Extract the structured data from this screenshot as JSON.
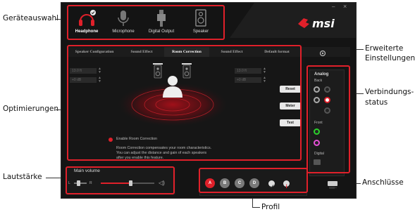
{
  "callouts": {
    "device_selection": "Geräteauswahl",
    "advanced_settings_line1": "Erweiterte",
    "advanced_settings_line2": "Einstellungen",
    "connection_status_line1": "Verbindungs-",
    "connection_status_line2": "status",
    "optimizations": "Optimierungen",
    "volume": "Lautstärke",
    "connectors": "Anschlüsse",
    "profile": "Profil"
  },
  "devices": [
    {
      "label": "Headphone",
      "icon": "headphone-icon",
      "selected": true
    },
    {
      "label": "Microphone",
      "icon": "microphone-icon",
      "selected": false
    },
    {
      "label": "Digital Output",
      "icon": "digital-output-icon",
      "selected": false
    },
    {
      "label": "Speaker",
      "icon": "speaker-icon",
      "selected": false
    }
  ],
  "brand": {
    "logo_text": "msi",
    "accent": "#e0202a"
  },
  "window_controls": {
    "minimize": "–",
    "close": "×"
  },
  "tabs": [
    {
      "label": "Speaker Configuration",
      "active": false
    },
    {
      "label": "Sound Effect",
      "active": false
    },
    {
      "label": "Room Correction",
      "active": true
    },
    {
      "label": "Sound Effect",
      "active": false
    },
    {
      "label": "Default format",
      "active": false
    }
  ],
  "room_correction": {
    "left_distance": "13.0 ft",
    "left_gain": "+0 dB",
    "right_distance": "13.0 ft",
    "right_gain": "+0 dB",
    "enable_label": "Enable Room Correction",
    "description_line1": "Room Correction compensates your room characteristics.",
    "description_line2": "You can adjust the distance and gain of each speakers",
    "description_line3": "after you enable this feature."
  },
  "side_buttons": {
    "reset": "Reset",
    "meter": "Meter",
    "test": "Test"
  },
  "connections": {
    "analog_label": "Analog",
    "back_label": "Back",
    "front_label": "Front",
    "digital_label": "Digital"
  },
  "volume": {
    "label": "Main volume",
    "left": "L",
    "right": "R",
    "level": 0.55
  },
  "profiles": [
    {
      "label": "A",
      "active": true
    },
    {
      "label": "B",
      "active": false
    },
    {
      "label": "C",
      "active": false
    },
    {
      "label": "D",
      "active": false
    }
  ]
}
